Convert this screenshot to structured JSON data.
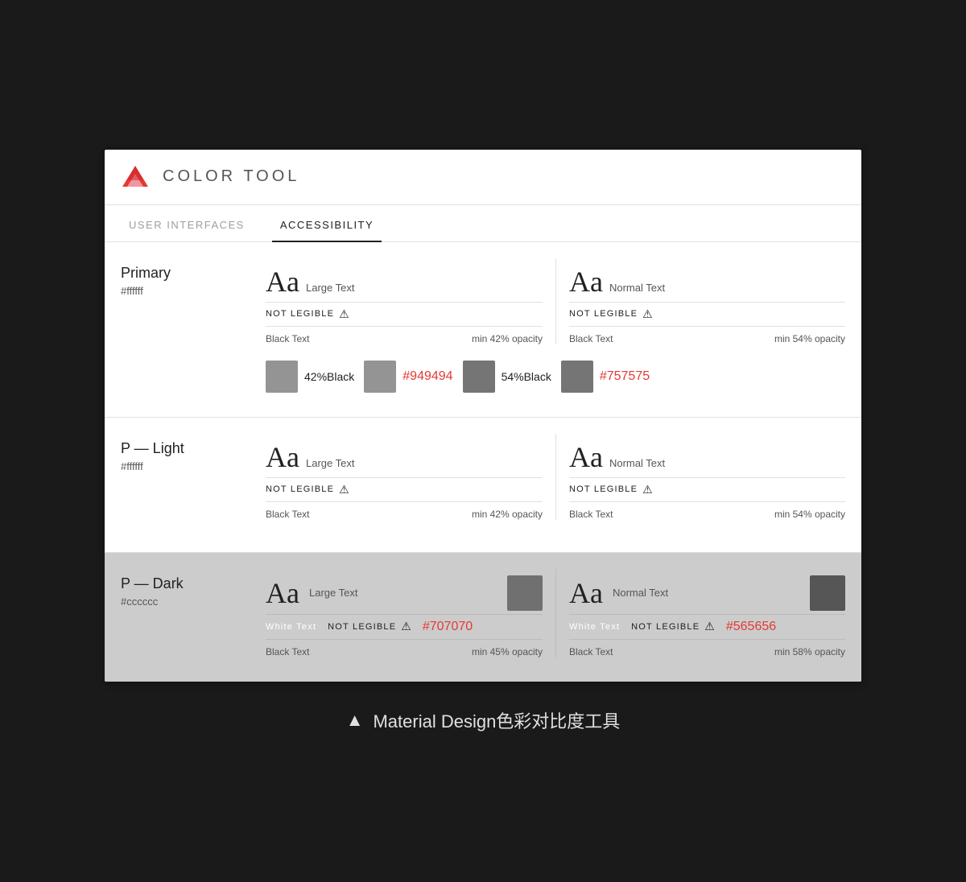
{
  "header": {
    "title": "COLOR  TOOL",
    "logo_alt": "Material Design Logo"
  },
  "tabs": [
    {
      "id": "user-interfaces",
      "label": "USER INTERFACES",
      "active": false
    },
    {
      "id": "accessibility",
      "label": "ACCESSIBILITY",
      "active": true
    }
  ],
  "sections": [
    {
      "id": "primary",
      "label": "Primary",
      "hex": "#ffffff",
      "background": "white",
      "large_text": {
        "aa_label": "Aa",
        "size_label": "Large Text",
        "legibility": "NOT LEGIBLE",
        "black_text_label": "Black Text",
        "opacity": "min 42% opacity"
      },
      "normal_text": {
        "aa_label": "Aa",
        "size_label": "Normal Text",
        "legibility": "NOT LEGIBLE",
        "black_text_label": "Black Text",
        "opacity": "min 54% opacity"
      },
      "swatches": [
        {
          "pct": "42%Black",
          "color": "#949494",
          "hex": "#949494"
        },
        {
          "pct": "54%Black",
          "color": "#757575",
          "hex": "#757575"
        }
      ]
    },
    {
      "id": "p-light",
      "label": "P — Light",
      "hex": "#ffffff",
      "background": "white",
      "large_text": {
        "aa_label": "Aa",
        "size_label": "Large Text",
        "legibility": "NOT LEGIBLE",
        "black_text_label": "Black Text",
        "opacity": "min 42% opacity"
      },
      "normal_text": {
        "aa_label": "Aa",
        "size_label": "Normal Text",
        "legibility": "NOT LEGIBLE",
        "black_text_label": "Black Text",
        "opacity": "min 54% opacity"
      },
      "swatches": []
    },
    {
      "id": "p-dark",
      "label": "P — Dark",
      "hex": "#cccccc",
      "background": "gray",
      "large_text": {
        "aa_label": "Aa",
        "size_label": "Large Text",
        "white_text_label": "White Text",
        "legibility": "NOT LEGIBLE",
        "swatch_color": "#707070",
        "swatch_hex": "#707070",
        "black_text_label": "Black Text",
        "opacity": "min 45% opacity"
      },
      "normal_text": {
        "aa_label": "Aa",
        "size_label": "Normal Text",
        "white_text_label": "White Text",
        "legibility": "NOT LEGIBLE",
        "swatch_color": "#565656",
        "swatch_hex": "#565656",
        "black_text_label": "Black Text",
        "opacity": "min 58% opacity"
      }
    }
  ],
  "caption": {
    "triangle": "▲",
    "text": "Material Design色彩对比度工具"
  }
}
